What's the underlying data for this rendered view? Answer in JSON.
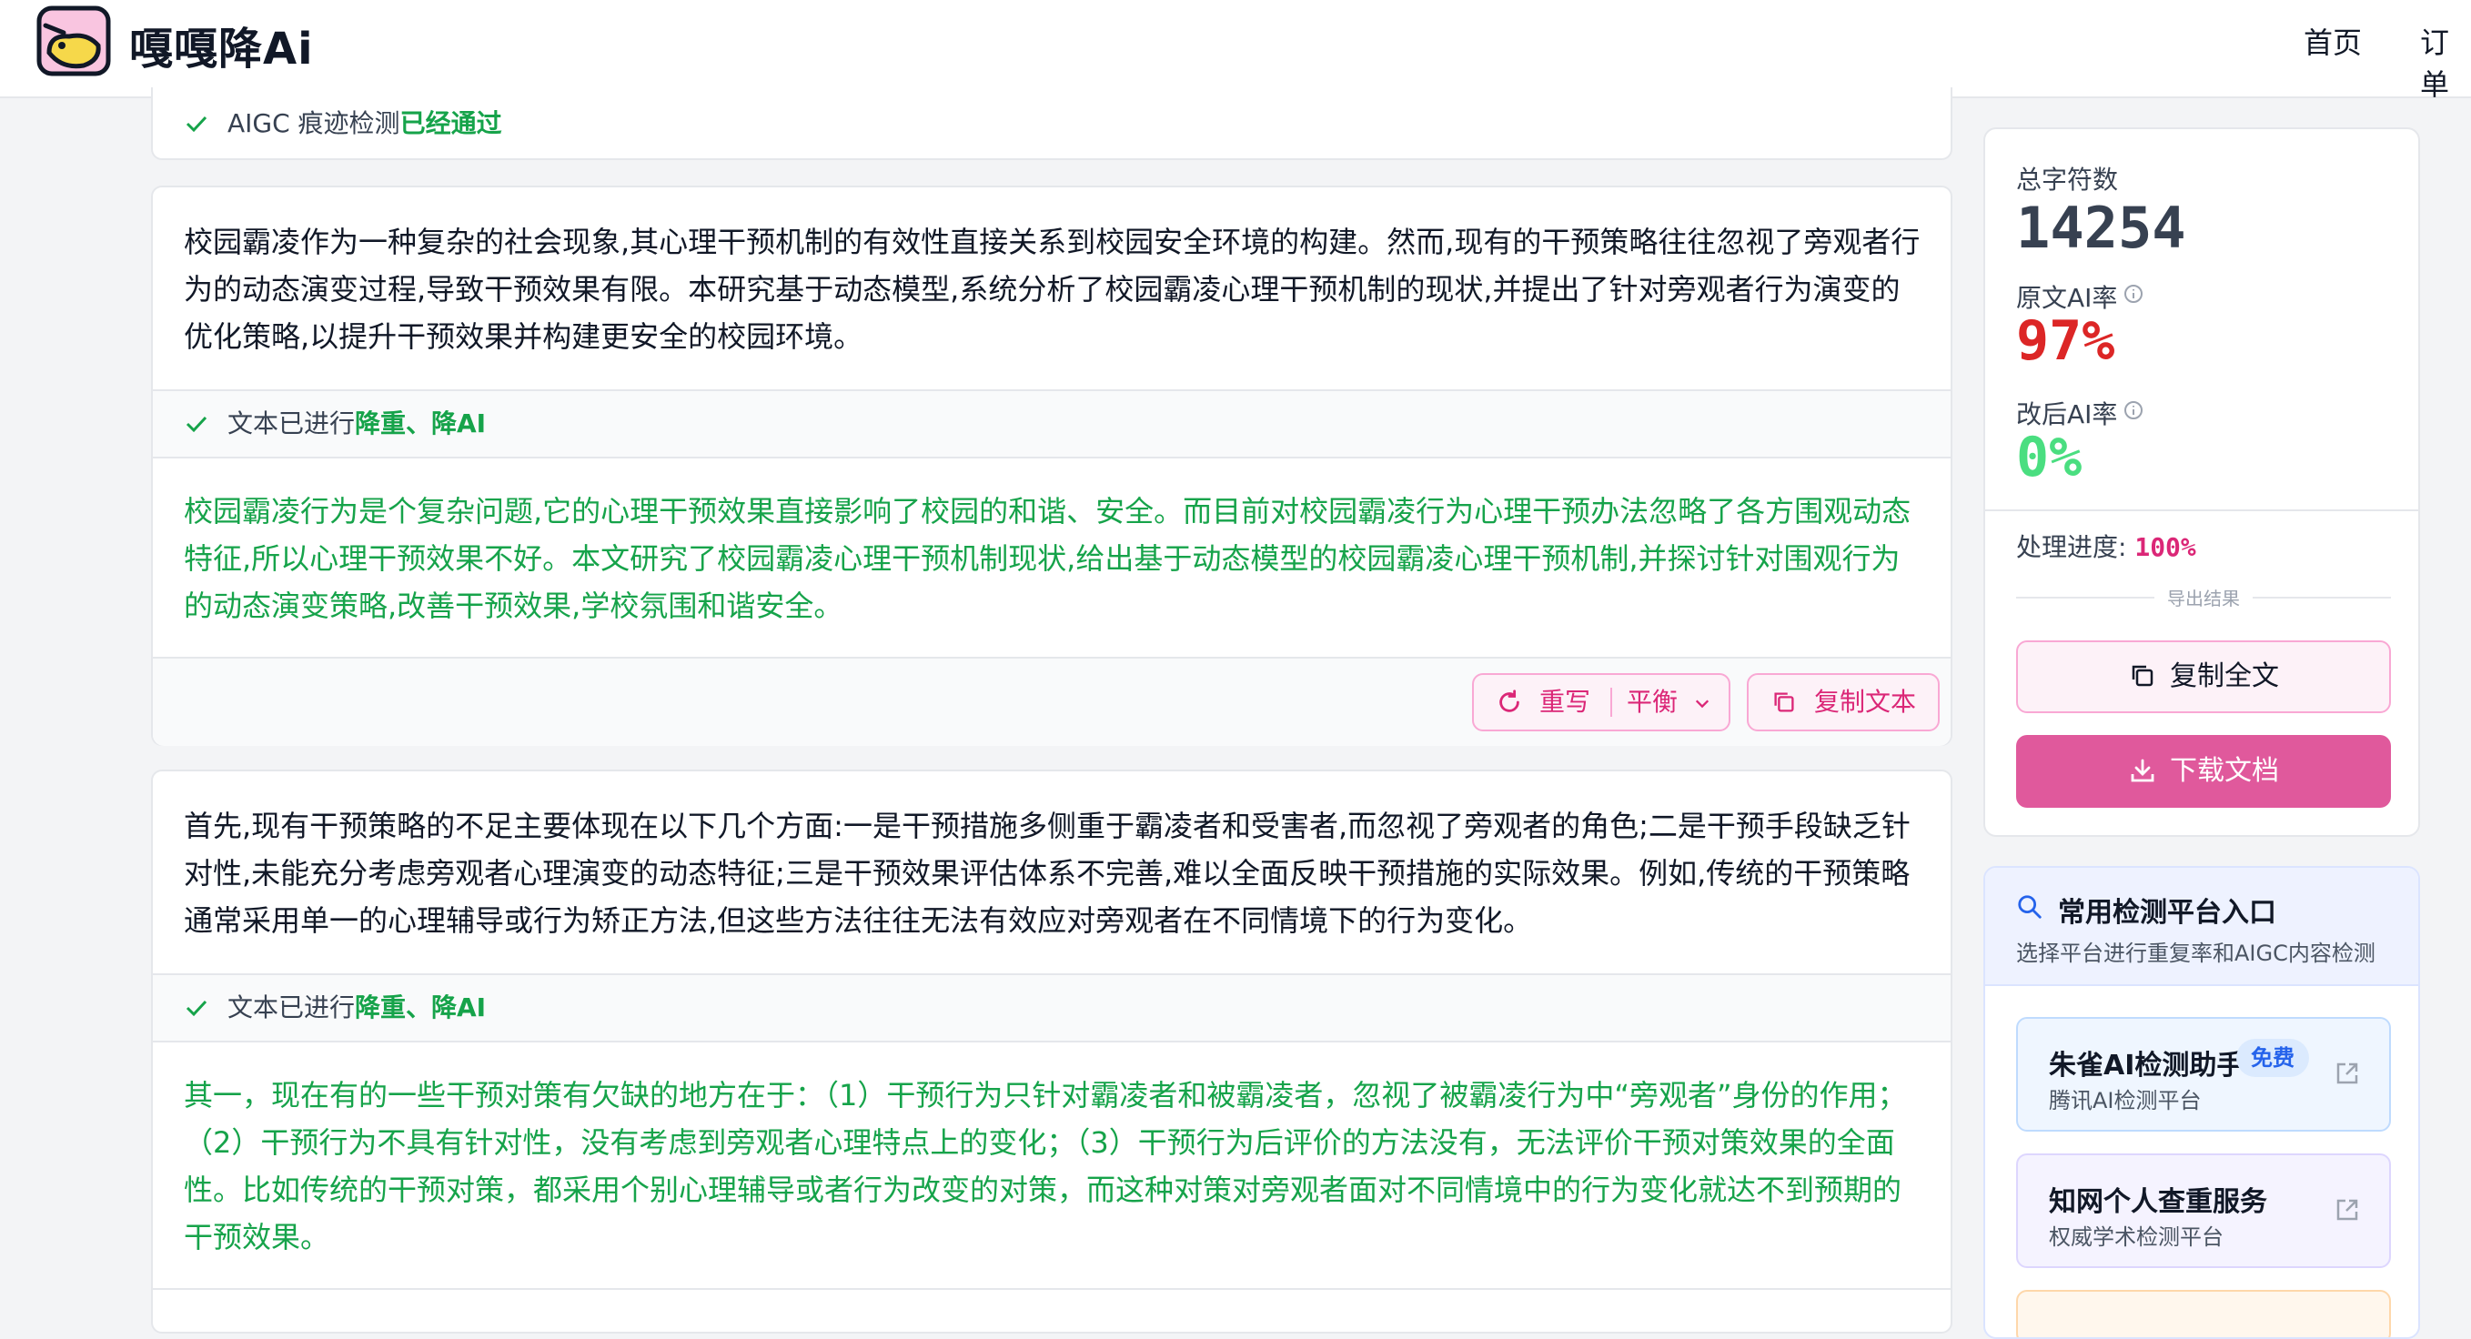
{
  "header": {
    "brand": "嘎嘎降Ai",
    "nav_home": "首页",
    "nav_orders": "订单"
  },
  "top_status": {
    "prefix": "AIGC 痕迹检测",
    "highlight": "已经通过"
  },
  "blocks": [
    {
      "original": "校园霸凌作为一种复杂的社会现象,其心理干预机制的有效性直接关系到校园安全环境的构建。然而,现有的干预策略往往忽视了旁观者行为的动态演变过程,导致干预效果有限。本研究基于动态模型,系统分析了校园霸凌心理干预机制的现状,并提出了针对旁观者行为演变的优化策略,以提升干预效果并构建更安全的校园环境。",
      "status_prefix": "文本已进行",
      "status_highlight": "降重、降AI",
      "rewritten": "校园霸凌行为是个复杂问题,它的心理干预效果直接影响了校园的和谐、安全。而目前对校园霸凌行为心理干预办法忽略了各方围观动态特征,所以心理干预效果不好。本文研究了校园霸凌心理干预机制现状,给出基于动态模型的校园霸凌心理干预机制,并探讨针对围观行为的动态演变策略,改善干预效果,学校氛围和谐安全。",
      "rewrite_label": "重写",
      "mode_label": "平衡",
      "copy_label": "复制文本"
    },
    {
      "original": "首先,现有干预策略的不足主要体现在以下几个方面:一是干预措施多侧重于霸凌者和受害者,而忽视了旁观者的角色;二是干预手段缺乏针对性,未能充分考虑旁观者心理演变的动态特征;三是干预效果评估体系不完善,难以全面反映干预措施的实际效果。例如,传统的干预策略通常采用单一的心理辅导或行为矫正方法,但这些方法往往无法有效应对旁观者在不同情境下的行为变化。",
      "status_prefix": "文本已进行",
      "status_highlight": "降重、降AI",
      "rewritten": "其一，现在有的一些干预对策有欠缺的地方在于：（1）干预行为只针对霸凌者和被霸凌者，忽视了被霸凌行为中“旁观者”身份的作用；（2）干预行为不具有针对性，没有考虑到旁观者心理特点上的变化；（3）干预行为后评价的方法没有，无法评价干预对策效果的全面性。比如传统的干预对策，都采用个别心理辅导或者行为改变的对策，而这种对策对旁观者面对不同情境中的行为变化就达不到预期的干预效果。"
    }
  ],
  "stats": {
    "total_chars_label": "总字符数",
    "total_chars": "14254",
    "orig_ai_label": "原文AI率",
    "orig_ai": "97%",
    "new_ai_label": "改后AI率",
    "new_ai": "0%",
    "progress_label": "处理进度:",
    "progress": "100%",
    "export_label": "导出结果",
    "copy_all": "复制全文",
    "download": "下载文档"
  },
  "platforms": {
    "title": "常用检测平台入口",
    "subtitle": "选择平台进行重复率和AIGC内容检测",
    "items": [
      {
        "name": "朱雀AI检测助手",
        "badge": "免费",
        "desc": "腾讯AI检测平台"
      },
      {
        "name": "知网个人查重服务",
        "desc": "权威学术检测平台"
      }
    ]
  },
  "colors": {
    "accent_pink": "#e0599c",
    "success_green": "#16a34a",
    "danger_red": "#dc2626",
    "info_blue": "#2563eb"
  }
}
